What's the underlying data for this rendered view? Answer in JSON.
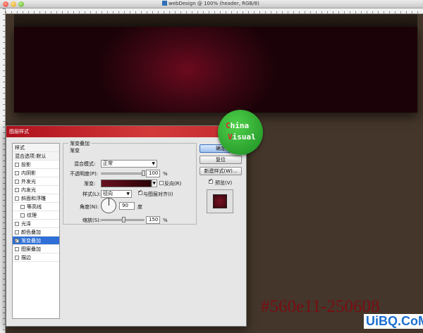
{
  "window": {
    "title": "webDesign @ 100% (header, RGB/8)"
  },
  "dialog": {
    "title": "图层样式",
    "close_label": "x",
    "styles_list": {
      "header": "样式",
      "blend_default": "混合选项:默认",
      "items": [
        {
          "label": "投影",
          "checked": false
        },
        {
          "label": "内阴影",
          "checked": false
        },
        {
          "label": "外发光",
          "checked": false
        },
        {
          "label": "内发光",
          "checked": false
        },
        {
          "label": "斜面和浮雕",
          "checked": false
        },
        {
          "label": "等高线",
          "checked": false
        },
        {
          "label": "纹理",
          "checked": false
        },
        {
          "label": "光泽",
          "checked": false
        },
        {
          "label": "颜色叠加",
          "checked": false
        },
        {
          "label": "渐变叠加",
          "checked": true,
          "selected": true
        },
        {
          "label": "图案叠加",
          "checked": false
        },
        {
          "label": "描边",
          "checked": false
        }
      ]
    },
    "panel": {
      "legend": "渐变叠加",
      "sub": "渐变",
      "blend_mode_label": "混合模式:",
      "blend_mode_value": "正常",
      "opacity_label": "不透明度(P):",
      "opacity_value": "100",
      "opacity_unit": "%",
      "gradient_label": "渐变:",
      "reverse_label": "反向(R)",
      "style_label": "样式(L):",
      "style_value": "径向",
      "align_label": "与图层对齐(I)",
      "angle_label": "角度(N):",
      "angle_value": "90",
      "angle_unit": "度",
      "scale_label": "缩放(S):",
      "scale_value": "150",
      "scale_unit": "%"
    },
    "buttons": {
      "ok": "确定",
      "reset": "复位",
      "new_style": "新建样式(W)...",
      "preview": "预览(V)"
    }
  },
  "logo": {
    "line1_first": "C",
    "line1_rest": "hina",
    "line2_first": "V",
    "line2_rest": "isual"
  },
  "annotation": {
    "hex": "#560e11-250608"
  },
  "watermark": {
    "site": "UiBQ.CoM"
  },
  "colors": {
    "dialog_title": "#c42a2f",
    "header_glow": "#6b0a1e",
    "canvas_bg": "#44362a",
    "annotation": "#7a0c12",
    "watermark": "#1a6fd1"
  }
}
